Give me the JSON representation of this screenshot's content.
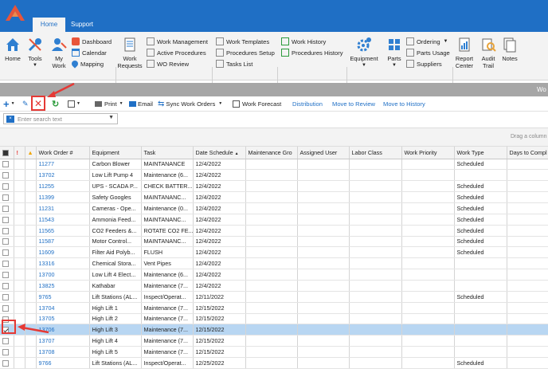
{
  "tabs": {
    "home": "Home",
    "support": "Support"
  },
  "ribbon": {
    "home": "Home",
    "tools": "Tools",
    "my_work": "My\nWork",
    "dashboard": "Dashboard",
    "calendar": "Calendar",
    "mapping": "Mapping",
    "work_requests": "Work\nRequests",
    "work_management": "Work Management",
    "active_procedures": "Active Procedures",
    "wo_review": "WO Review",
    "work_templates": "Work Templates",
    "procedures_setup": "Procedures Setup",
    "tasks_list": "Tasks List",
    "work_history": "Work History",
    "procedures_history": "Procedures History",
    "equipment": "Equipment",
    "parts": "Parts",
    "ordering": "Ordering",
    "parts_usage": "Parts Usage",
    "suppliers": "Suppliers",
    "report_center": "Report\nCenter",
    "audit_trail": "Audit\nTrail",
    "notes": "Notes"
  },
  "panel_title": "Wo",
  "toolbar": {
    "print": "Print",
    "email": "Email",
    "sync": "Sync Work Orders",
    "forecast": "Work Forecast",
    "distribution": "Distribution",
    "move_review": "Move to Review",
    "move_history": "Move to History"
  },
  "search": {
    "placeholder": "Enter search text"
  },
  "drag_hint": "Drag a column",
  "columns": [
    "Work Order #",
    "Equipment",
    "Task",
    "Date Schedule",
    "Maintenance Gro",
    "Assigned User",
    "Labor Class",
    "Work Priority",
    "Work Type",
    "Days to Compl"
  ],
  "rows": [
    {
      "wo": "11277",
      "equip": "Carbon Blower",
      "task": "MAINTANANCE",
      "date": "12/4/2022",
      "type": "Scheduled",
      "checked": false
    },
    {
      "wo": "13702",
      "equip": "Low Lift Pump 4",
      "task": "Maintenance (6...",
      "date": "12/4/2022",
      "type": "",
      "checked": false
    },
    {
      "wo": "11255",
      "equip": "UPS - SCADA P...",
      "task": "CHECK BATTER...",
      "date": "12/4/2022",
      "type": "Scheduled",
      "checked": false
    },
    {
      "wo": "11399",
      "equip": "Safety Googles",
      "task": "MAINTANANC...",
      "date": "12/4/2022",
      "type": "Scheduled",
      "checked": false
    },
    {
      "wo": "11231",
      "equip": "Cameras - Ope...",
      "task": "Maintenance (0...",
      "date": "12/4/2022",
      "type": "Scheduled",
      "checked": false
    },
    {
      "wo": "11543",
      "equip": "Ammonia Feed...",
      "task": "MAINTANANC...",
      "date": "12/4/2022",
      "type": "Scheduled",
      "checked": false
    },
    {
      "wo": "11565",
      "equip": "CO2 Feeders &...",
      "task": "ROTATE CO2 FE...",
      "date": "12/4/2022",
      "type": "Scheduled",
      "checked": false
    },
    {
      "wo": "11587",
      "equip": "Motor Control...",
      "task": "MAINTANANC...",
      "date": "12/4/2022",
      "type": "Scheduled",
      "checked": false
    },
    {
      "wo": "11609",
      "equip": "Filter Aid Polyb...",
      "task": "FLUSH",
      "date": "12/4/2022",
      "type": "Scheduled",
      "checked": false
    },
    {
      "wo": "13316",
      "equip": "Chemical Stora...",
      "task": "Vent Pipes",
      "date": "12/4/2022",
      "type": "",
      "checked": false
    },
    {
      "wo": "13700",
      "equip": "Low Lift 4 Elect...",
      "task": "Maintenance (6...",
      "date": "12/4/2022",
      "type": "",
      "checked": false
    },
    {
      "wo": "13825",
      "equip": "Kathabar",
      "task": "Maintenance (7...",
      "date": "12/4/2022",
      "type": "",
      "checked": false
    },
    {
      "wo": "9765",
      "equip": "Lift Stations (AL...",
      "task": "Inspect/Operat...",
      "date": "12/11/2022",
      "type": "Scheduled",
      "checked": false
    },
    {
      "wo": "13704",
      "equip": "High Lift 1",
      "task": "Maintenance (7...",
      "date": "12/15/2022",
      "type": "",
      "checked": false
    },
    {
      "wo": "13705",
      "equip": "High Lift 2",
      "task": "Maintenance (7...",
      "date": "12/15/2022",
      "type": "",
      "checked": false
    },
    {
      "wo": "13706",
      "equip": "High Lift 3",
      "task": "Maintenance (7...",
      "date": "12/15/2022",
      "type": "",
      "checked": true
    },
    {
      "wo": "13707",
      "equip": "High Lift 4",
      "task": "Maintenance (7...",
      "date": "12/15/2022",
      "type": "",
      "checked": false
    },
    {
      "wo": "13708",
      "equip": "High Lift 5",
      "task": "Maintenance (7...",
      "date": "12/15/2022",
      "type": "",
      "checked": false
    },
    {
      "wo": "9766",
      "equip": "Lift Stations (AL...",
      "task": "Inspect/Operat...",
      "date": "12/25/2022",
      "type": "Scheduled",
      "checked": false
    }
  ],
  "colors": {
    "accent": "#1f6fc5",
    "selected_row": "#b8d6f2",
    "highlight": "#e53935"
  }
}
